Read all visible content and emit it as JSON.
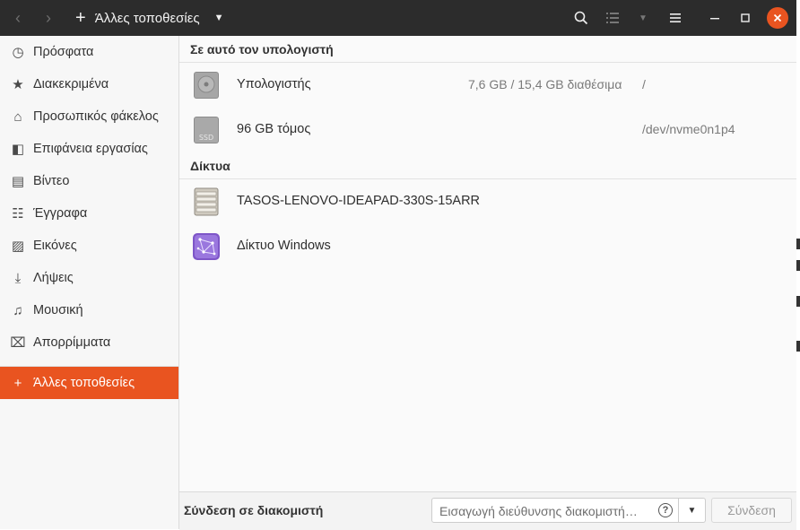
{
  "header": {
    "back_icon": "chevron-left-icon",
    "forward_icon": "chevron-right-icon",
    "location_label": "Άλλες τοποθεσίες"
  },
  "sidebar": {
    "items": [
      {
        "label": "Πρόσφατα",
        "icon": "clock-icon"
      },
      {
        "label": "Διακεκριμένα",
        "icon": "star-icon"
      },
      {
        "label": "Προσωπικός φάκελος",
        "icon": "home-icon"
      },
      {
        "label": "Επιφάνεια εργασίας",
        "icon": "desktop-icon"
      },
      {
        "label": "Βίντεο",
        "icon": "video-icon"
      },
      {
        "label": "Έγγραφα",
        "icon": "document-icon"
      },
      {
        "label": "Εικόνες",
        "icon": "image-icon"
      },
      {
        "label": "Λήψεις",
        "icon": "download-icon"
      },
      {
        "label": "Μουσική",
        "icon": "music-icon"
      },
      {
        "label": "Απορρίμματα",
        "icon": "trash-icon"
      }
    ],
    "other_locations": "Άλλες τοποθεσίες"
  },
  "main": {
    "on_this_computer": {
      "heading": "Σε αυτό τον υπολογιστή",
      "items": [
        {
          "name": "Υπολογιστής",
          "space": "7,6 GB / 15,4 GB διαθέσιμα",
          "path": "/",
          "icon": "harddisk-icon"
        },
        {
          "name": "96 GB τόμος",
          "space": "",
          "path": "/dev/nvme0n1p4",
          "icon": "ssd-icon",
          "icon_text": "SSD"
        }
      ]
    },
    "networks": {
      "heading": "Δίκτυα",
      "items": [
        {
          "name": "TASOS-LENOVO-IDEAPAD-330S-15ARR",
          "icon": "server-icon"
        },
        {
          "name": "Δίκτυο Windows",
          "icon": "network-icon"
        }
      ]
    }
  },
  "bottom": {
    "label": "Σύνδεση σε διακομιστή",
    "placeholder": "Εισαγωγή διεύθυνσης διακομιστή…",
    "help": "?",
    "connect_label": "Σύνδεση"
  },
  "colors": {
    "accent": "#e95420",
    "headerbar": "#2c2c2c"
  }
}
